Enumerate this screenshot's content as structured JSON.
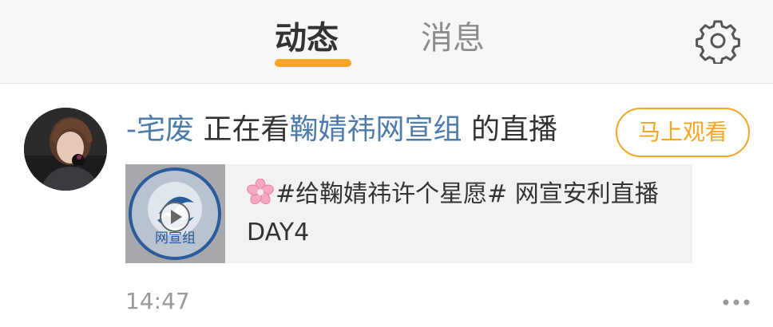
{
  "header": {
    "tabs": [
      {
        "label": "动态",
        "active": true
      },
      {
        "label": "消息",
        "active": false
      }
    ],
    "settings_icon": "gear-icon"
  },
  "post": {
    "user": "-宅废",
    "action": "正在看",
    "channel": "鞠婧祎网宣组",
    "suffix": "的直播",
    "watch_button": "马上观看",
    "card": {
      "title": "#给鞠婧祎许个星愿# 网宣安利直播DAY4",
      "thumbnail_logo_text": "网宣组",
      "title_icon": "cherry-blossom-icon",
      "play_icon": "play-icon"
    },
    "time": "14:47",
    "more_icon": "more-dots-icon"
  },
  "colors": {
    "accent": "#f5a623",
    "link": "#4d7bab",
    "text": "#333333",
    "muted": "#999999"
  }
}
